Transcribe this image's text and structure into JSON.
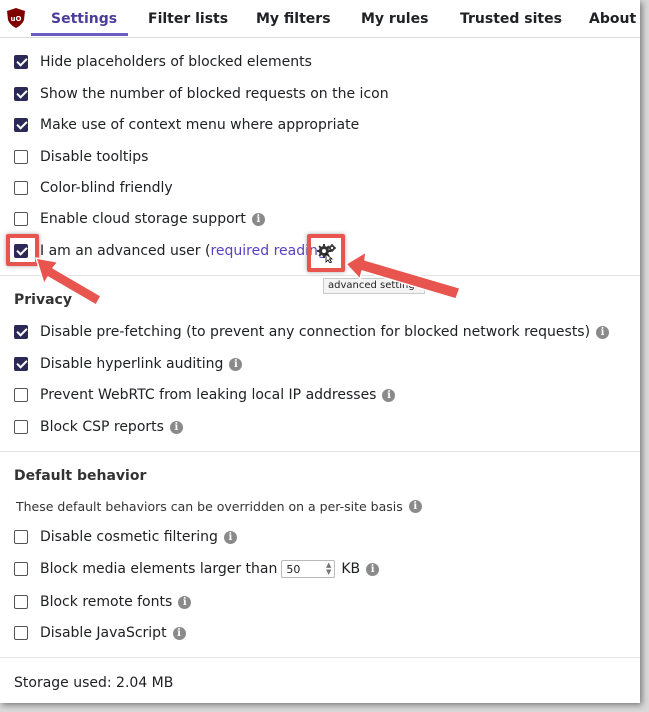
{
  "tabs": [
    {
      "label": "Settings",
      "active": true
    },
    {
      "label": "Filter lists"
    },
    {
      "label": "My filters"
    },
    {
      "label": "My rules"
    },
    {
      "label": "Trusted sites"
    },
    {
      "label": "About"
    }
  ],
  "appearance": {
    "hide_placeholders": {
      "label": "Hide placeholders of blocked elements",
      "checked": true
    },
    "show_count": {
      "label": "Show the number of blocked requests on the icon",
      "checked": true
    },
    "context_menu": {
      "label": "Make use of context menu where appropriate",
      "checked": true
    },
    "disable_tooltips": {
      "label": "Disable tooltips",
      "checked": false
    },
    "color_blind": {
      "label": "Color-blind friendly",
      "checked": false
    },
    "cloud_storage": {
      "label": "Enable cloud storage support",
      "checked": false
    },
    "advanced_user": {
      "label": "I am an advanced user (",
      "link": "required reading",
      "checked": true
    },
    "advanced_tooltip": "advanced settings"
  },
  "privacy": {
    "title": "Privacy",
    "prefetch": {
      "label": "Disable pre-fetching (to prevent any connection for blocked network requests)",
      "checked": true
    },
    "hyperlink": {
      "label": "Disable hyperlink auditing",
      "checked": true
    },
    "webrtc": {
      "label": "Prevent WebRTC from leaking local IP addresses",
      "checked": false
    },
    "csp": {
      "label": "Block CSP reports",
      "checked": false
    }
  },
  "default_behavior": {
    "title": "Default behavior",
    "note": "These default behaviors can be overridden on a per-site basis",
    "cosmetic": {
      "label": "Disable cosmetic filtering",
      "checked": false
    },
    "media": {
      "label": "Block media elements larger than",
      "value": "50",
      "unit": "KB",
      "checked": false
    },
    "fonts": {
      "label": "Block remote fonts",
      "checked": false
    },
    "javascript": {
      "label": "Disable JavaScript",
      "checked": false
    }
  },
  "storage": {
    "label": "Storage used: 2.04 MB"
  },
  "icons": {
    "info": "i",
    "logo": "uO"
  },
  "colors": {
    "accent": "#4b3d9a",
    "checkbox": "#2b2a57",
    "annotation": "#e8554e",
    "link": "#5b3fc4"
  }
}
